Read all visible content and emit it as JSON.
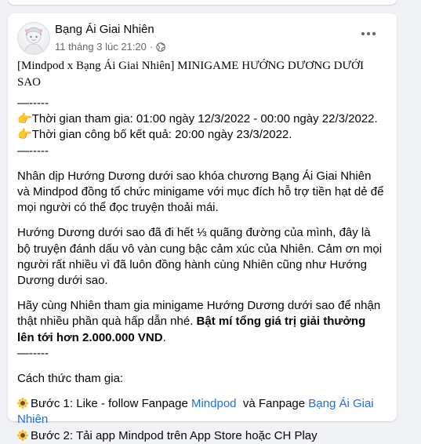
{
  "post": {
    "author": "Bạng Ái Giai Nhiên",
    "timestamp": "11 tháng 3 lúc 21:20",
    "separator": "·",
    "title": "[Mindpod x Bạng Ái Giai Nhiên] MINIGAME HƯỚNG DƯƠNG DƯỚI SAO",
    "divider": "—-----",
    "schedule": [
      {
        "emoji": "👉",
        "text": "Thời gian tham gia: 01:00 ngày 12/3/2022 - 00:00 ngày 22/3/2022."
      },
      {
        "emoji": "👉",
        "text": "Thời gian công bố kết quả: 20:00 ngày 23/3/2022."
      }
    ],
    "paragraph1": "Nhân dịp Hướng Dương dưới sao khóa chương Bạng Ái Giai Nhiên và Mindpod đồng tổ chức minigame với mục đích hỗ trợ tiền hạt dẻ để mọi người có thể đọc truyện thoải mái.",
    "paragraph2": "Hướng Dương dưới sao đã đi hết ⅓ quãng đường của mình, đây là bộ truyện đánh dấu vô vàn cung bậc cảm xúc của Nhiên. Cảm ơn mọi người rất nhiều vì đã luôn đồng hành cùng Nhiên cũng như Hướng Dương dưới sao.",
    "paragraph3_plain": "Hãy cùng Nhiên tham gia minigame Hướng Dương dưới sao để nhận thật nhiều phần quà hấp dẫn nhé. ",
    "paragraph3_bold": "Bật mí tổng giá trị giải thưởng lên tới hơn 2.000.000 VND",
    "paragraph3_end": ".",
    "howto_heading": "Cách thức tham gia:",
    "step1": {
      "text_before": "Bước 1: Like - follow Fanpage ",
      "link1": "Mindpod",
      "text_middle": "  và Fanpage ",
      "link2": "Bạng Ái Giai Nhiên"
    },
    "step2": {
      "text": "Bước 2: Tải app Mindpod trên App Store hoặc CH Play"
    }
  },
  "icons": {
    "more": "more-horizontal-icon",
    "globe": "globe-icon",
    "pointer": "backhand-index-pointing-right-icon",
    "sunflower": "sunflower-icon"
  },
  "colors": {
    "link": "#216fdb",
    "secondary_text": "#65676b",
    "background": "#f0f2f5",
    "card": "#ffffff"
  }
}
